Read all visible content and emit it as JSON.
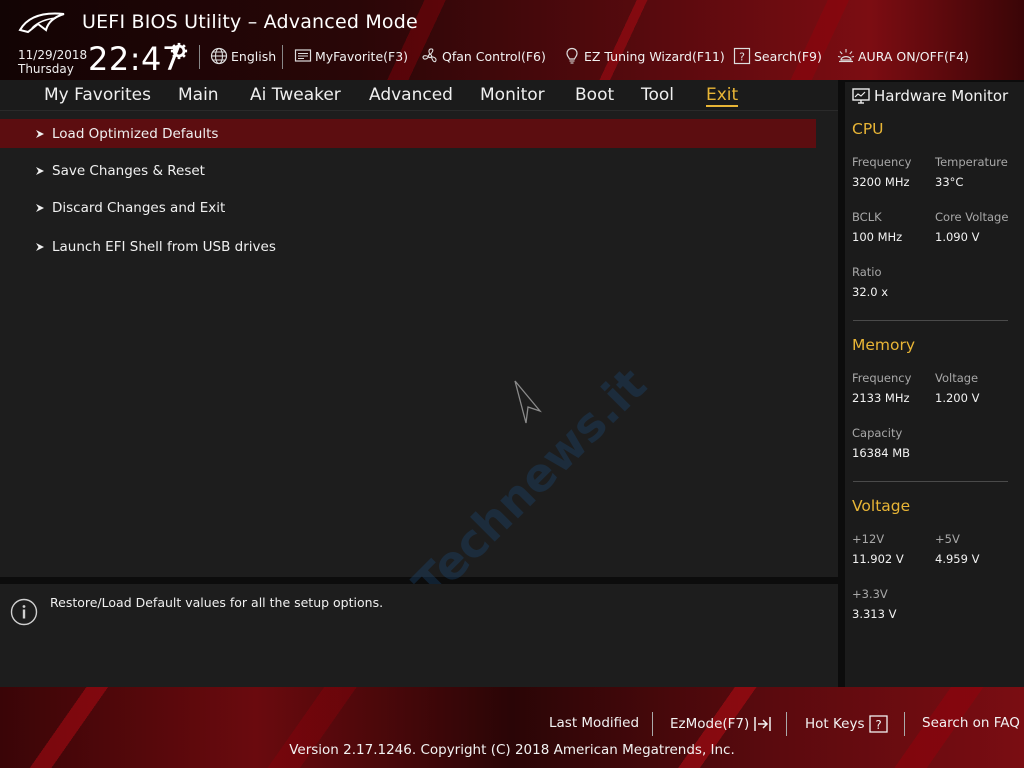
{
  "header": {
    "title": "UEFI BIOS Utility – Advanced Mode",
    "date": "11/29/2018",
    "day": "Thursday",
    "time": "22:47",
    "items": {
      "language": "English",
      "myfavorite": "MyFavorite(F3)",
      "qfan": "Qfan Control(F6)",
      "ez_tuning": "EZ Tuning Wizard(F11)",
      "search": "Search(F9)",
      "aura": "AURA ON/OFF(F4)"
    }
  },
  "nav": {
    "tabs": [
      "My Favorites",
      "Main",
      "Ai Tweaker",
      "Advanced",
      "Monitor",
      "Boot",
      "Tool",
      "Exit"
    ],
    "active_tab": "Exit"
  },
  "main": {
    "items": [
      "Load Optimized Defaults",
      "Save Changes & Reset",
      "Discard Changes and Exit",
      "Launch EFI Shell from USB drives"
    ],
    "selected_index": 0
  },
  "help": {
    "text": "Restore/Load Default values for all the setup options."
  },
  "hardware_monitor": {
    "title": "Hardware Monitor",
    "cpu": {
      "heading": "CPU",
      "frequency_label": "Frequency",
      "frequency": "3200 MHz",
      "temperature_label": "Temperature",
      "temperature": "33°C",
      "bclk_label": "BCLK",
      "bclk": "100 MHz",
      "core_voltage_label": "Core Voltage",
      "core_voltage": "1.090 V",
      "ratio_label": "Ratio",
      "ratio": "32.0 x"
    },
    "memory": {
      "heading": "Memory",
      "frequency_label": "Frequency",
      "frequency": "2133 MHz",
      "voltage_label": "Voltage",
      "voltage": "1.200 V",
      "capacity_label": "Capacity",
      "capacity": "16384 MB"
    },
    "voltage": {
      "heading": "Voltage",
      "v12_label": "+12V",
      "v12": "11.902 V",
      "v5_label": "+5V",
      "v5": "4.959 V",
      "v33_label": "+3.3V",
      "v33": "3.313 V"
    }
  },
  "footer": {
    "last_modified": "Last Modified",
    "ezmode": "EzMode(F7)",
    "hot_keys": "Hot Keys",
    "search_faq": "Search on FAQ",
    "copyright": "Version 2.17.1246. Copyright (C) 2018 American Megatrends, Inc."
  },
  "watermark": "Technews.it",
  "colors": {
    "accent": "#e8b536",
    "selection": "#5c0d10",
    "panel": "#1d1d1d",
    "brand_red": "#7c0d12"
  }
}
